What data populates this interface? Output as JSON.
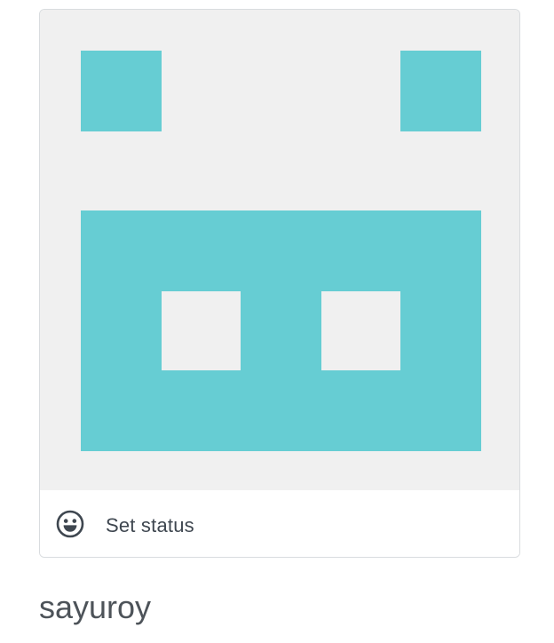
{
  "profile": {
    "username": "sayuroy",
    "status_label": "Set status",
    "status_icon": "smiley-icon"
  },
  "identicon": {
    "foreground_color": "#66cdd3",
    "background_color": "#f0f0f0"
  },
  "colors": {
    "status_text": "#3f4750",
    "username_text": "#4d5359",
    "card_border": "#d9dcdf"
  }
}
